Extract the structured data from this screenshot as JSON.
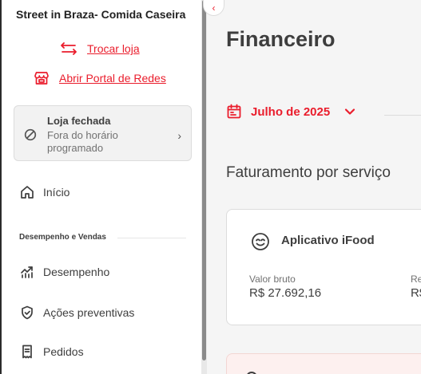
{
  "sidebar": {
    "store_name": "Street in Braza- Comida Caseira",
    "switch_store": "Trocar loja",
    "open_portal": "Abrir Portal de Redes",
    "status": {
      "title": "Loja fechada",
      "subtitle": "Fora do horário programado"
    },
    "home": "Início",
    "section_title": "Desempenho e Vendas",
    "items": [
      {
        "label": "Desempenho",
        "icon": "chart-icon"
      },
      {
        "label": "Ações preventivas",
        "icon": "shield-icon"
      },
      {
        "label": "Pedidos",
        "icon": "receipt-icon"
      }
    ]
  },
  "main": {
    "title": "Financeiro",
    "month": "Julho de 2025",
    "section_heading": "Faturamento por serviço",
    "service_card": {
      "name": "Aplicativo iFood",
      "gross_label": "Valor bruto",
      "gross_value": "R$ 27.692,16",
      "second_label": "Re",
      "second_value": "R$"
    }
  },
  "colors": {
    "accent": "#ea1d2c",
    "text": "#3e3e3e",
    "background": "#f5f5f5"
  }
}
